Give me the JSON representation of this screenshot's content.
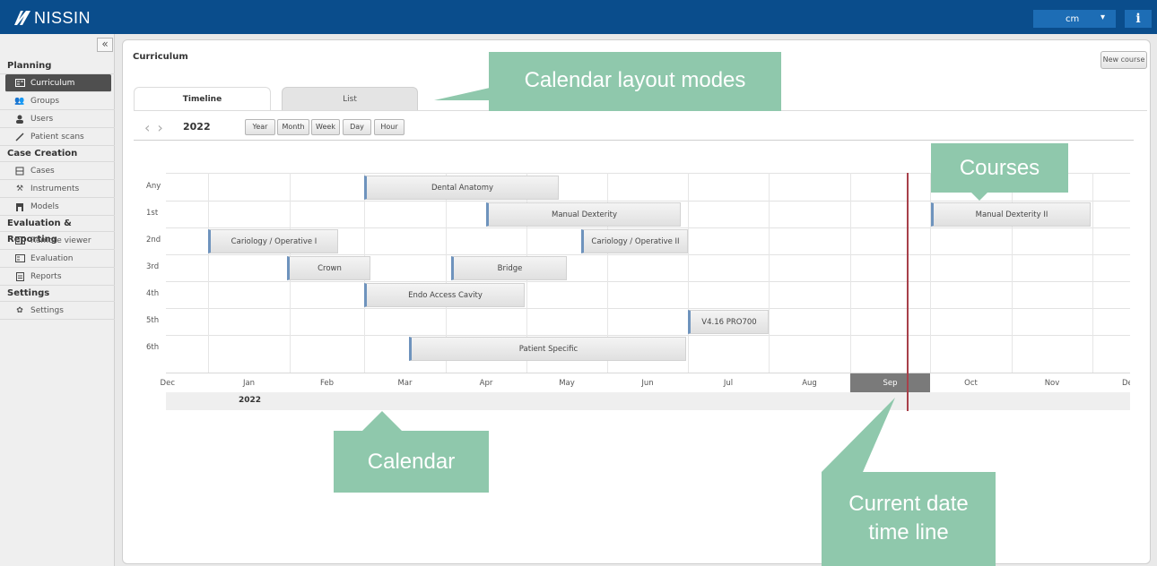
{
  "app": {
    "logo": "NISSIN",
    "user": "cm",
    "user_caret": "▾",
    "info": "i"
  },
  "sidebar": {
    "collapse": "«",
    "sections": [
      {
        "title": "Planning",
        "items": [
          {
            "label": "Curriculum",
            "icon": "grid-icon",
            "active": true
          },
          {
            "label": "Groups",
            "icon": "groups-icon"
          },
          {
            "label": "Users",
            "icon": "user-icon"
          },
          {
            "label": "Patient scans",
            "icon": "wand-icon"
          }
        ]
      },
      {
        "title": "Case Creation",
        "items": [
          {
            "label": "Cases",
            "icon": "cases-icon"
          },
          {
            "label": "Instruments",
            "icon": "instruments-icon"
          },
          {
            "label": "Models",
            "icon": "models-icon"
          }
        ]
      },
      {
        "title": "Evaluation & Reporting",
        "items": [
          {
            "label": "Remote viewer",
            "icon": "grid-icon"
          },
          {
            "label": "Evaluation",
            "icon": "grid-icon"
          },
          {
            "label": "Reports",
            "icon": "report-icon"
          }
        ]
      },
      {
        "title": "Settings",
        "items": [
          {
            "label": "Settings",
            "icon": "gear-icon"
          }
        ]
      }
    ]
  },
  "main": {
    "title": "Curriculum",
    "new_course": "New course",
    "tabs": {
      "timeline": "Timeline",
      "list": "List"
    },
    "year": "2022",
    "scale_buttons": [
      "Year",
      "Month",
      "Week",
      "Day",
      "Hour"
    ]
  },
  "timeline": {
    "rows": [
      "Any",
      "1st",
      "2nd",
      "3rd",
      "4th",
      "5th",
      "6th"
    ],
    "months": [
      "Dec",
      "Jan",
      "Feb",
      "Mar",
      "Apr",
      "May",
      "Jun",
      "Jul",
      "Aug",
      "Sep",
      "Oct",
      "Nov",
      "Dec"
    ],
    "current_month": "Sep",
    "year_label": "2022",
    "courses": [
      {
        "label": "Dental Anatomy",
        "row": "Any",
        "start_month": "Mar",
        "end_month": "May"
      },
      {
        "label": "Manual Dexterity",
        "row": "1st",
        "start_month": "Apr",
        "end_month": "Jul"
      },
      {
        "label": "Manual Dexterity II",
        "row": "1st",
        "start_month": "Oct",
        "end_month": "Nov"
      },
      {
        "label": "Cariology / Operative I",
        "row": "2nd",
        "start_month": "Jan",
        "end_month": "Feb"
      },
      {
        "label": "Cariology / Operative II",
        "row": "2nd",
        "start_month": "Jun",
        "end_month": "Jul"
      },
      {
        "label": "Crown",
        "row": "3rd",
        "start_month": "Feb",
        "end_month": "Mar"
      },
      {
        "label": "Bridge",
        "row": "3rd",
        "start_month": "Apr",
        "end_month": "May"
      },
      {
        "label": "Endo Access Cavity",
        "row": "4th",
        "start_month": "Mar",
        "end_month": "May"
      },
      {
        "label": "V4.16 PRO700",
        "row": "5th",
        "start_month": "Jul",
        "end_month": "Aug"
      },
      {
        "label": "Patient Specific",
        "row": "6th",
        "start_month": "Mar",
        "end_month": "Jul"
      }
    ]
  },
  "annotations": {
    "layout_modes": "Calendar layout modes",
    "courses": "Courses",
    "calendar": "Calendar",
    "current_date_1": "Current date",
    "current_date_2": "time line"
  },
  "colors": {
    "topbar": "#0a4d8c",
    "callout": "#8fc8ac",
    "now_line": "#a8404a",
    "bar_accent": "#6e93bd"
  }
}
